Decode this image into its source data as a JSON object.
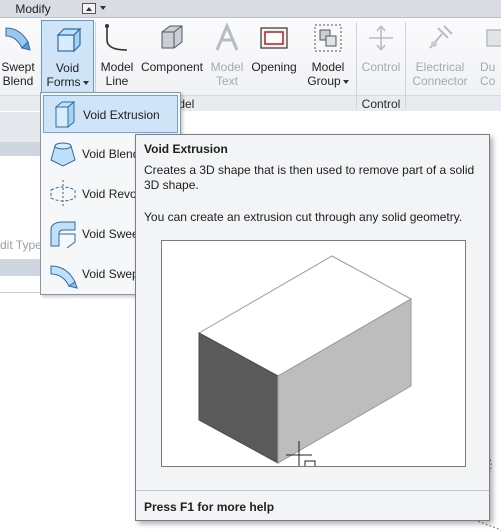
{
  "tabs": {
    "active": "Modify"
  },
  "ribbon": {
    "tools": {
      "swept_blend": "Swept\nBlend",
      "void_forms": "Void\nForms",
      "model_line": "Model\nLine",
      "component": "Component",
      "model_text": "Model\nText",
      "opening": "Opening",
      "model_group": "Model\nGroup",
      "control": "Control",
      "electrical_connector": "Electrical\nConnector",
      "partial": "Du\nCo"
    },
    "groups": {
      "model": "Model",
      "control": "Control"
    }
  },
  "menu": {
    "items": [
      {
        "label": "Void Extrusion",
        "icon": "void-extrusion-icon",
        "selected": true
      },
      {
        "label": "Void Blend",
        "icon": "void-blend-icon"
      },
      {
        "label": "Void Revolve",
        "icon": "void-revolve-icon"
      },
      {
        "label": "Void Sweep",
        "icon": "void-sweep-icon"
      },
      {
        "label": "Void Swept Blend",
        "icon": "void-swept-blend-icon"
      }
    ]
  },
  "properties": {
    "edit_type": "Edit Type"
  },
  "tooltip": {
    "title": "Void Extrusion",
    "description": "Creates a 3D shape that is then used to remove part of a solid 3D shape.",
    "extra": "You can create an extrusion cut through any solid geometry.",
    "help": "Press F1 for more help"
  },
  "colors": {
    "accent": "#cfe4f7",
    "accent_border": "#5f9ad3"
  }
}
